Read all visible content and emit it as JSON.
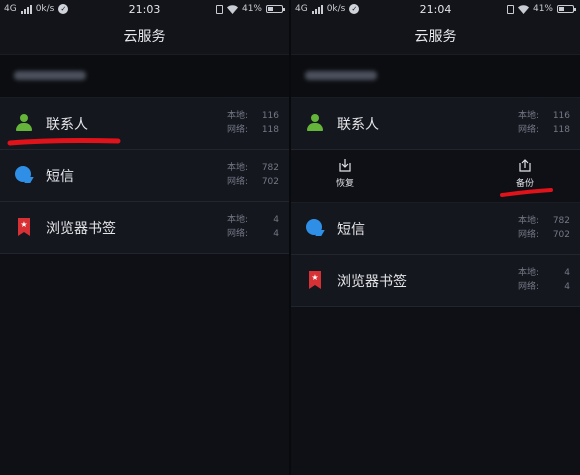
{
  "colors": {
    "accent_red": "#e0121a",
    "contact_green": "#65b53a",
    "sms_blue": "#2f8fe6",
    "bookmark_red": "#d83135"
  },
  "left": {
    "status": {
      "network": "4G",
      "speed": "0k/s",
      "time": "21:03",
      "battery": "41%",
      "battery_level": 0.41
    },
    "title": "云服务",
    "items": [
      {
        "label": "联系人",
        "icon": "person-icon",
        "local_label": "本地:",
        "local": "116",
        "net_label": "网络:",
        "net": "118"
      },
      {
        "label": "短信",
        "icon": "sms-icon",
        "local_label": "本地:",
        "local": "782",
        "net_label": "网络:",
        "net": "702"
      },
      {
        "label": "浏览器书签",
        "icon": "bookmark-icon",
        "local_label": "本地:",
        "local": "4",
        "net_label": "网络:",
        "net": "4"
      }
    ]
  },
  "right": {
    "status": {
      "network": "4G",
      "speed": "0k/s",
      "time": "21:04",
      "battery": "41%",
      "battery_level": 0.41
    },
    "title": "云服务",
    "items": [
      {
        "label": "联系人",
        "icon": "person-icon",
        "local_label": "本地:",
        "local": "116",
        "net_label": "网络:",
        "net": "118"
      },
      {
        "label": "短信",
        "icon": "sms-icon",
        "local_label": "本地:",
        "local": "782",
        "net_label": "网络:",
        "net": "702"
      },
      {
        "label": "浏览器书签",
        "icon": "bookmark-icon",
        "local_label": "本地:",
        "local": "4",
        "net_label": "网络:",
        "net": "4"
      }
    ],
    "actions": {
      "restore": "恢复",
      "backup": "备份"
    }
  }
}
